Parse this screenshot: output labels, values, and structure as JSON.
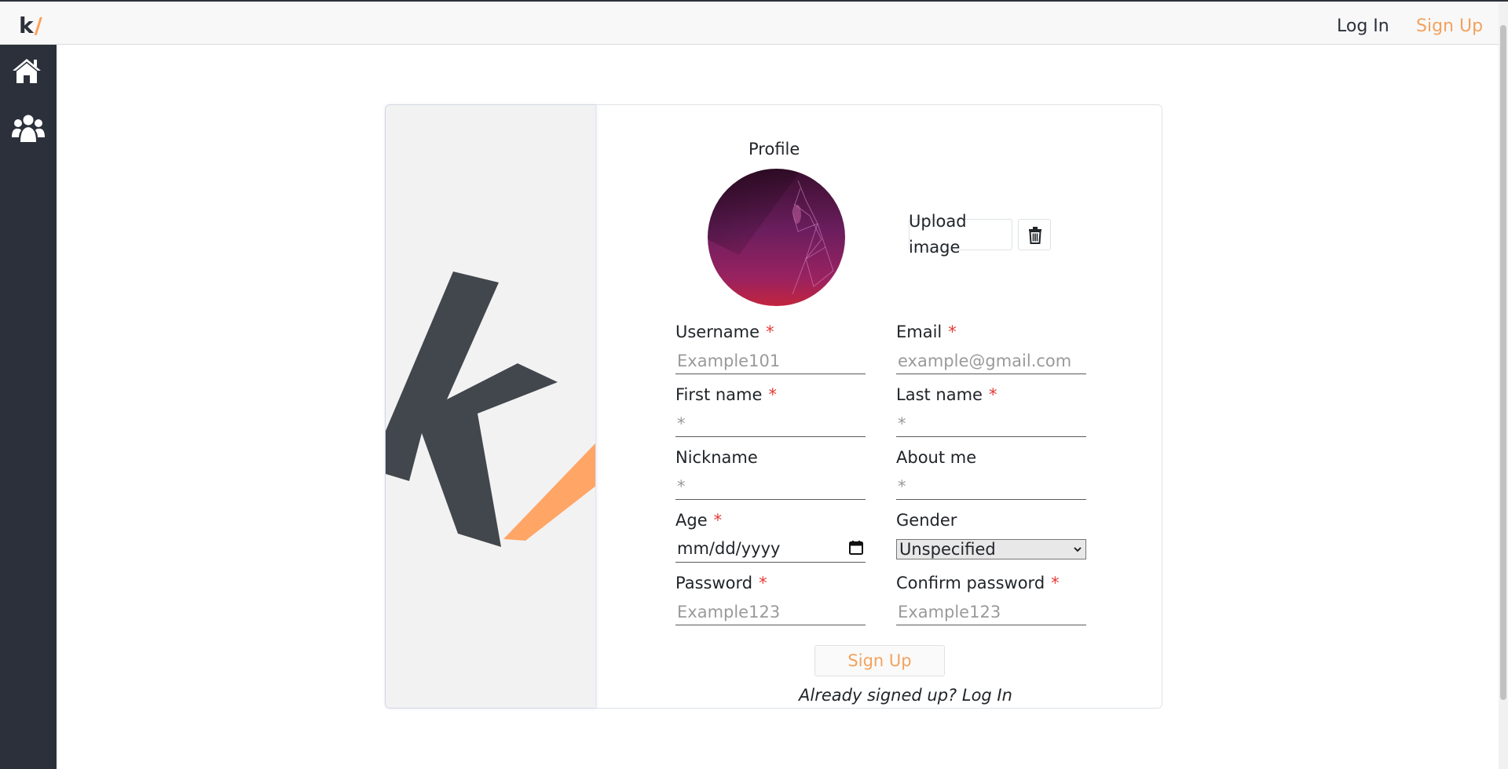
{
  "header": {
    "brand_k": "k",
    "brand_slash": "/",
    "login_label": "Log In",
    "signup_label": "Sign Up"
  },
  "sidebar": {
    "items": [
      {
        "icon": "home-icon"
      },
      {
        "icon": "users-icon"
      }
    ]
  },
  "form": {
    "profile_title": "Profile",
    "upload_label": "Upload image",
    "delete_icon": "trash-icon",
    "username": {
      "label": "Username",
      "required": "*",
      "placeholder": "Example101"
    },
    "email": {
      "label": "Email",
      "required": "*",
      "placeholder": "example@gmail.com"
    },
    "first_name": {
      "label": "First name",
      "required": "*",
      "placeholder": "*"
    },
    "last_name": {
      "label": "Last name",
      "required": "*",
      "placeholder": "*"
    },
    "nickname": {
      "label": "Nickname",
      "placeholder": "*"
    },
    "about_me": {
      "label": "About me",
      "placeholder": "*"
    },
    "age": {
      "label": "Age",
      "required": "*",
      "value": "mm/dd/yyyy"
    },
    "gender": {
      "label": "Gender",
      "value": "Unspecified"
    },
    "password": {
      "label": "Password",
      "required": "*",
      "placeholder": "Example123"
    },
    "confirm_password": {
      "label": "Confirm password",
      "required": "*",
      "placeholder": "Example123"
    },
    "submit_label": "Sign Up",
    "already_text": "Already signed up?",
    "already_link": "Log In"
  },
  "colors": {
    "sidebar": "#2b303a",
    "accent": "#ff9f55",
    "required": "#e53935"
  }
}
